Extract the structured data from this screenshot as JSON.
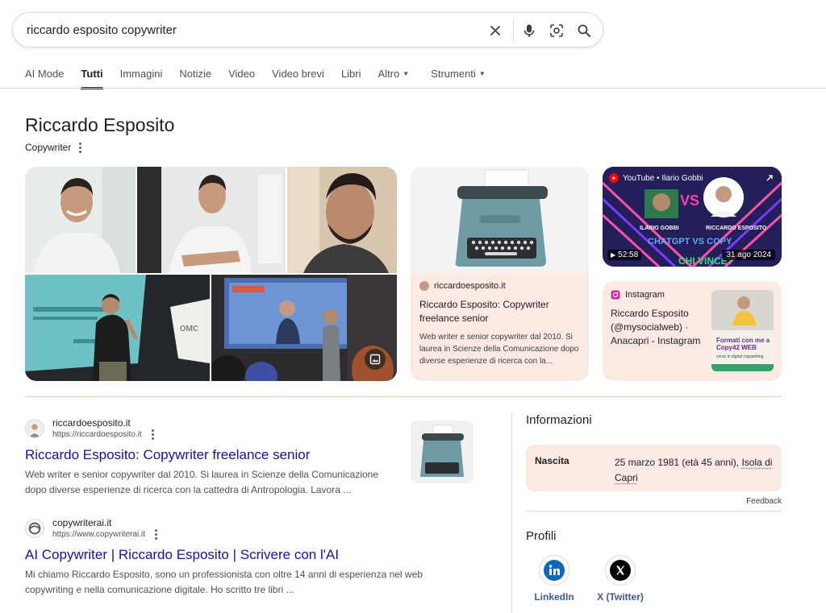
{
  "search": {
    "query": "riccardo esposito copywriter"
  },
  "tabs": [
    {
      "label": "AI Mode"
    },
    {
      "label": "Tutti",
      "active": true
    },
    {
      "label": "Immagini"
    },
    {
      "label": "Notizie"
    },
    {
      "label": "Video"
    },
    {
      "label": "Video brevi"
    },
    {
      "label": "Libri"
    },
    {
      "label": "Altro"
    },
    {
      "label": "Strumenti"
    }
  ],
  "entity": {
    "name": "Riccardo Esposito",
    "subtitle": "Copywriter"
  },
  "cards": {
    "website": {
      "source": "riccardoesposito.it",
      "title": "Riccardo Esposito: Copywriter freelance senior",
      "desc": "Web writer e senior copywriter dal 2010. Si laurea in Scienze della Comunicazione dopo diverse esperienze di ricerca con la..."
    },
    "youtube": {
      "source": "YouTube • Ilario Gobbi",
      "duration": "52:58",
      "date": "31 ago 2024",
      "overlay_name_left": "ILARIO GOBBI",
      "overlay_name_right": "RICCARDO ESPOSITO",
      "overlay_vs": "VS",
      "overlay_headline": "CHI VINCE?",
      "overlay_top": "CHATGPT VS COPY"
    },
    "instagram": {
      "source": "Instagram",
      "title": "Riccardo Esposito (@mysocialweb) · Anacapri - Instagram",
      "thumb_text": "Formati con me a Copy42 WEB",
      "thumb_small": "corso in digital copywriting"
    }
  },
  "results": [
    {
      "site": "riccardoesposito.it",
      "url": "https://riccardoesposito.it",
      "title": "Riccardo Esposito: Copywriter freelance senior",
      "desc": "Web writer e senior copywriter dal 2010. Si laurea in Scienze della Comunicazione dopo diverse esperienze di ricerca con la cattedra di Antropologia. Lavora ..."
    },
    {
      "site": "copywriterai.it",
      "url": "https://www.copywriterai.it",
      "title": "AI Copywriter | Riccardo Esposito | Scrivere con l'AI",
      "desc": "Mi chiamo Riccardo Esposito, sono un professionista con oltre 14 anni di esperienza nel web copywriting e nella comunicazione digitale. Ho scritto tre libri ..."
    }
  ],
  "info": {
    "title": "Informazioni",
    "birth_label": "Nascita",
    "birth_value": "25 marzo 1981 (età 45 anni), ",
    "birth_place": "Isola di Capri",
    "feedback": "Feedback"
  },
  "profiles": {
    "title": "Profili",
    "items": [
      {
        "label": "LinkedIn"
      },
      {
        "label": "X (Twitter)"
      }
    ]
  },
  "colors": {
    "link": "#1a0dab",
    "card_bg": "#fbe9e4",
    "divider": "#f2c7b8"
  }
}
